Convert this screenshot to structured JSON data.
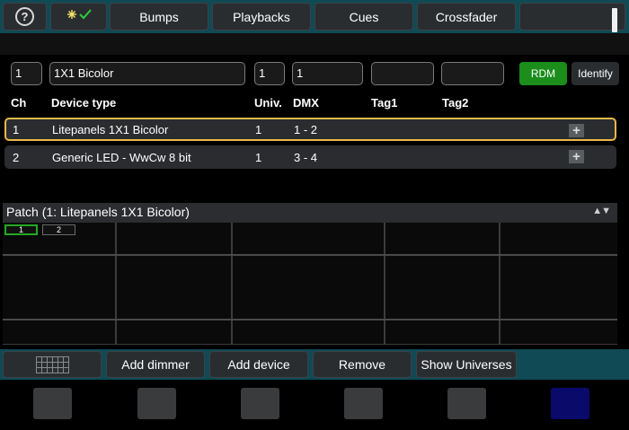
{
  "toolbar": {
    "help_glyph": "?",
    "tabs": [
      {
        "label": "Bumps"
      },
      {
        "label": "Playbacks"
      },
      {
        "label": "Cues"
      },
      {
        "label": "Crossfader"
      }
    ]
  },
  "form": {
    "channel": "1",
    "device_type": "1X1 Bicolor",
    "universe": "1",
    "dmx": "1",
    "tag1": "",
    "tag2": "",
    "rdm_label": "RDM",
    "identify_label": "Identify"
  },
  "table": {
    "headers": {
      "ch": "Ch",
      "device_type": "Device type",
      "univ": "Univ.",
      "dmx": "DMX",
      "tag1": "Tag1",
      "tag2": "Tag2"
    },
    "rows": [
      {
        "ch": "1",
        "device_type": "Litepanels 1X1 Bicolor",
        "univ": "1",
        "dmx": "1 - 2"
      },
      {
        "ch": "2",
        "device_type": "Generic LED - WwCw 8 bit",
        "univ": "1",
        "dmx": "3 - 4"
      }
    ]
  },
  "patch": {
    "title": "Patch   (1: Litepanels 1X1 Bicolor)",
    "arrows": "▲▼",
    "chips": [
      "1",
      "2"
    ]
  },
  "bottom": {
    "buttons": [
      {
        "label": "Add dimmer"
      },
      {
        "label": "Add device"
      },
      {
        "label": "Remove"
      },
      {
        "label": "Show Universes"
      }
    ]
  },
  "colors": {
    "accent_teal": "#0f4a55",
    "rdm_green": "#1a8d1a",
    "selection_border": "#e8b84a"
  }
}
